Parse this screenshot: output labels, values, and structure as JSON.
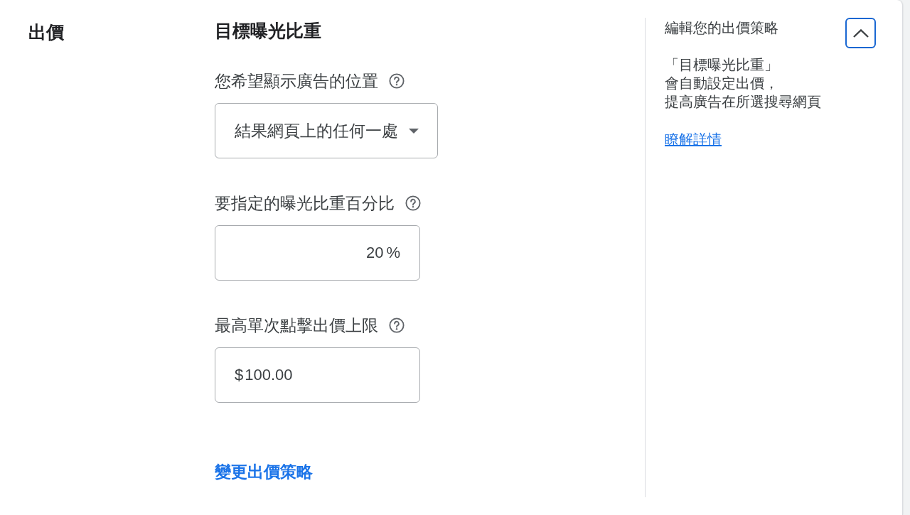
{
  "section": {
    "title": "出價"
  },
  "strategy": {
    "title": "目標曝光比重",
    "fields": [
      {
        "kind": "dropdown",
        "label": "您希望顯示廣告的位置",
        "value": "結果網頁上的任何一處"
      },
      {
        "kind": "input",
        "label": "要指定的曝光比重百分比",
        "value": "20",
        "suffix": "%"
      },
      {
        "kind": "input",
        "label": "最高單次點擊出價上限",
        "prefix": "$",
        "value": "100.00"
      }
    ],
    "change_link": "變更出價策略"
  },
  "help_panel": {
    "title": "編輯您的出價策略",
    "expanded": true,
    "description_lines": [
      "「目標曝光比重」",
      "會自動設定出價，",
      "提高廣告在所選搜尋網頁"
    ],
    "link": "瞭解詳情"
  }
}
